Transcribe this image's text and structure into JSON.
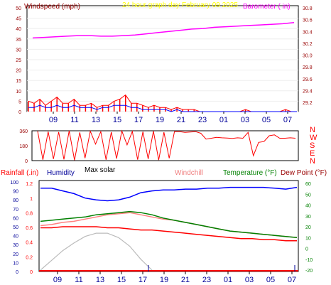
{
  "colors": {
    "red": "#ff0000",
    "blue": "#0000ff",
    "magenta": "#ff00ff",
    "yellow": "#ffff00",
    "darkred": "#990000",
    "gray": "#bbbbbb",
    "green": "#008000",
    "navy": "#000099",
    "salmon": "#f08080",
    "pink": "#ff8080"
  },
  "chart_data": [
    {
      "id": "wind-baro",
      "type": "line",
      "title": "24 hour graph day   February 09 2025",
      "left_axis_label": "Windspeed (mph)",
      "right_axis_label": "Barometer ( in)",
      "left_ticks": [
        0,
        5,
        10,
        15,
        20,
        25,
        30,
        35,
        40,
        45,
        50
      ],
      "right_ticks": [
        "29.2",
        "29.4",
        "29.6",
        "29.8",
        "30.0",
        "30.2",
        "30.4",
        "30.6",
        "30.8"
      ],
      "left_range": [
        0,
        50
      ],
      "right_range": [
        29.2,
        30.8
      ],
      "x_ticks": [
        "09",
        "11",
        "13",
        "15",
        "17",
        "19",
        "21",
        "23",
        "01",
        "03",
        "05",
        "07"
      ],
      "series": [
        {
          "role": "gust",
          "color": "red",
          "values": [
            5,
            4,
            6,
            3,
            5,
            7,
            4,
            4,
            6,
            3,
            3,
            4,
            2,
            3,
            3,
            5,
            6,
            8,
            4,
            4,
            3,
            2,
            3,
            2,
            2,
            1,
            2,
            1,
            1,
            1,
            0,
            0,
            0,
            0,
            0,
            0,
            0,
            0,
            1,
            0,
            0,
            0,
            0,
            0,
            0,
            1,
            0,
            0
          ]
        },
        {
          "role": "average",
          "color": "blue",
          "values": [
            2,
            2,
            3,
            2,
            2,
            3,
            2,
            2,
            3,
            2,
            2,
            2,
            1,
            2,
            2,
            3,
            3,
            3,
            2,
            2,
            1,
            1,
            1,
            1,
            1,
            0,
            1,
            0,
            0,
            0,
            0,
            0,
            0,
            0,
            0,
            0,
            0,
            0,
            0,
            0,
            0,
            0,
            0,
            0,
            0,
            0,
            0,
            0
          ]
        },
        {
          "role": "barometer",
          "color": "magenta",
          "values": [
            30.29,
            30.3,
            30.31,
            30.32,
            30.33,
            30.33,
            30.32,
            30.32,
            30.33,
            30.34,
            30.36,
            30.38,
            30.4,
            30.42,
            30.44,
            30.45,
            30.47,
            30.48,
            30.49,
            30.5,
            30.51,
            30.52,
            30.53,
            30.55
          ]
        }
      ]
    },
    {
      "id": "wind-direction",
      "type": "line",
      "left_ticks": [
        0,
        180,
        360
      ],
      "left_range": [
        0,
        360
      ],
      "right_labels": [
        "N",
        "W",
        "S",
        "E",
        "N"
      ],
      "series": [
        {
          "role": "direction",
          "color": "red",
          "values": [
            355,
            10,
            350,
            20,
            345,
            15,
            360,
            5,
            340,
            30,
            355,
            200,
            350,
            10,
            345,
            25,
            358,
            190,
            352,
            12,
            348,
            20,
            356,
            8,
            342,
            28,
            350,
            350,
            340,
            345,
            350,
            330,
            260,
            270,
            280,
            275,
            272,
            268,
            275,
            270,
            340,
            60,
            220,
            230,
            300,
            310,
            270,
            270,
            275,
            270
          ]
        }
      ]
    },
    {
      "id": "temp-humidity",
      "type": "line",
      "top_labels": {
        "rainfall": "Rainfall (.in)",
        "humidity": "Humidity",
        "max_solar": "Max solar",
        "windchill": "Windchill",
        "temperature": "Temperature (°F)",
        "dew_point": "Dew Point (°F)"
      },
      "rain_ticks": [
        "0",
        "0.2",
        "0.4",
        "0.6",
        "0.8",
        "1",
        "1.2"
      ],
      "humidity_ticks": [
        0,
        10,
        20,
        30,
        40,
        50,
        60,
        70,
        80,
        90,
        100
      ],
      "temp_ticks": [
        -20,
        -10,
        0,
        10,
        20,
        30,
        40,
        50,
        60
      ],
      "temp_range": [
        -20,
        60
      ],
      "humidity_range": [
        0,
        100
      ],
      "x_ticks": [
        "09",
        "11",
        "13",
        "15",
        "17",
        "19",
        "21",
        "23",
        "01",
        "03",
        "05",
        "07"
      ],
      "series": [
        {
          "role": "temperature",
          "color": "green",
          "values": [
            25,
            26,
            27,
            28,
            29,
            31,
            32,
            33,
            34,
            33,
            31,
            28,
            26,
            24,
            22,
            20,
            18,
            16,
            15,
            14,
            13,
            12,
            11,
            10
          ]
        },
        {
          "role": "dew_point",
          "color": "red",
          "values": [
            19,
            19,
            20,
            20,
            20,
            20,
            19,
            19,
            18,
            17,
            17,
            16,
            15,
            14,
            13,
            12,
            11,
            10,
            9,
            9,
            8,
            8,
            7,
            7
          ]
        },
        {
          "role": "windchill",
          "color": "pink",
          "values": [
            21,
            22,
            24,
            25,
            27,
            29,
            31,
            32,
            33,
            31,
            29,
            27,
            26,
            24,
            22,
            20,
            18,
            16,
            15,
            14,
            13,
            12,
            11,
            10
          ]
        },
        {
          "role": "humidity",
          "color": "blue",
          "values": [
            93,
            93,
            90,
            87,
            82,
            80,
            79,
            80,
            83,
            88,
            90,
            91,
            91,
            92,
            92,
            93,
            93,
            94,
            94,
            94,
            94,
            93,
            92,
            94
          ]
        },
        {
          "role": "max_solar",
          "color": "gray",
          "values": [
            0,
            9,
            18,
            25,
            31,
            34,
            34,
            30,
            22,
            10,
            0,
            0,
            0,
            0,
            0,
            0,
            0,
            0,
            0,
            0,
            0,
            0,
            0,
            0
          ]
        }
      ]
    }
  ]
}
